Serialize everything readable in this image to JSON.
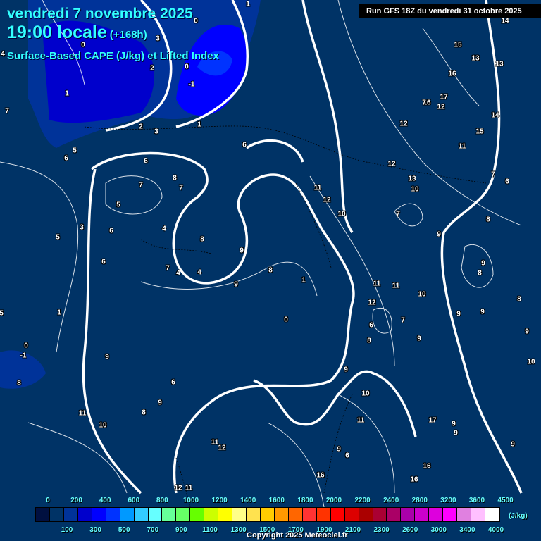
{
  "header": {
    "date": "vendredi 7 novembre 2025",
    "time": "19:00 locale",
    "lead": "(+168h)",
    "parameter": "Surface-Based CAPE (J/kg) et Lifted Index",
    "run": "Run GFS 18Z du vendredi 31 octobre 2025"
  },
  "map": {
    "contour_labels": [
      "1",
      "0",
      "3",
      "2",
      "0",
      "-1",
      "1",
      "4",
      "7",
      "0",
      "2",
      "3",
      "1",
      "5",
      "6",
      "6",
      "6",
      "8",
      "7",
      "7",
      "5",
      "4",
      "3",
      "5",
      "6",
      "6",
      "7",
      "4",
      "8",
      "9",
      "4",
      "8",
      "9",
      "1",
      "0",
      "1",
      "0",
      "5",
      "-1",
      "9",
      "8",
      "6",
      "9",
      "8",
      "11",
      "10",
      "11",
      "12",
      "12",
      "11",
      "11",
      "12",
      "10",
      "11",
      "12",
      "11",
      "10",
      "6",
      "7",
      "8",
      "9",
      "9",
      "10",
      "11",
      "9",
      "6",
      "16",
      "16",
      "16",
      "17",
      "16",
      "15",
      "13",
      "14",
      "13",
      "16",
      "17",
      "7",
      "12",
      "12",
      "14",
      "15",
      "11",
      "12",
      "13",
      "10",
      "7",
      "7",
      "6",
      "9",
      "8",
      "9",
      "8",
      "9",
      "9",
      "9",
      "9",
      "8",
      "9",
      "10",
      "9"
    ]
  },
  "legend": {
    "top_labels": [
      "0",
      "200",
      "400",
      "600",
      "800",
      "1000",
      "1200",
      "1400",
      "1600",
      "1800",
      "2000",
      "2200",
      "2400",
      "2800",
      "3200",
      "3600",
      "4500"
    ],
    "bottom_labels": [
      "100",
      "300",
      "500",
      "700",
      "900",
      "1100",
      "1300",
      "1500",
      "1700",
      "1900",
      "2100",
      "2300",
      "2600",
      "3000",
      "3400",
      "4000"
    ],
    "unit": "(J/kg)",
    "colors": [
      "#001040",
      "#003366",
      "#003399",
      "#0000cc",
      "#0000ff",
      "#0033ff",
      "#0099ff",
      "#33ccff",
      "#66ffff",
      "#66ff99",
      "#66ff66",
      "#66ff00",
      "#ccff00",
      "#ffff00",
      "#ffff88",
      "#ffe24f",
      "#ffcc00",
      "#ff9900",
      "#ff6600",
      "#ff3333",
      "#ff3300",
      "#ff0000",
      "#dd0000",
      "#aa0000",
      "#aa0033",
      "#aa0066",
      "#aa00aa",
      "#cc00cc",
      "#dd00dd",
      "#ff00ff",
      "#e080e0",
      "#ffc0ff",
      "#ffffff"
    ]
  },
  "copyright": "Copyright 2025 Meteociel.fr"
}
